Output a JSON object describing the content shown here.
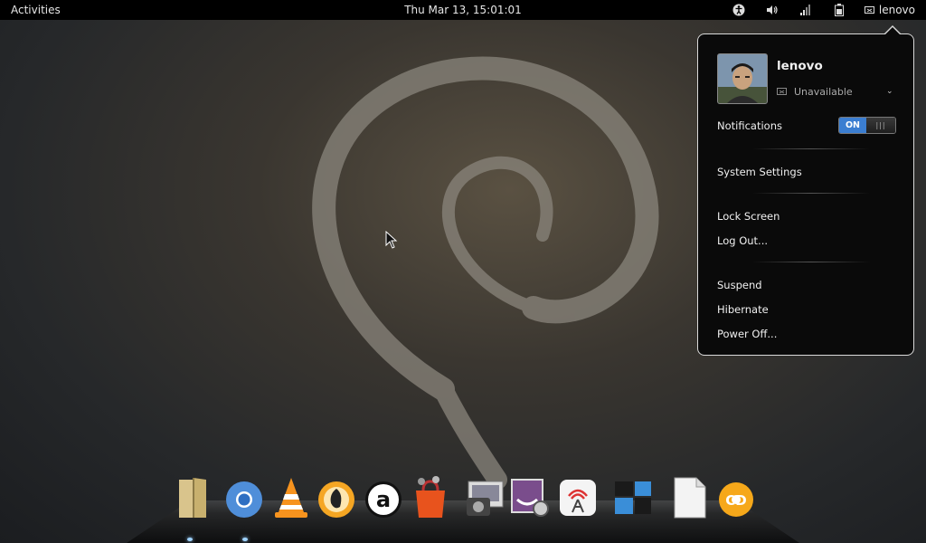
{
  "topbar": {
    "activities": "Activities",
    "clock": "Thu Mar 13, 15:01:01",
    "icons": [
      "accessibility-icon",
      "volume-icon",
      "network-signal-icon",
      "battery-icon"
    ],
    "user_label": "lenovo"
  },
  "user_menu": {
    "username": "lenovo",
    "status": "Unavailable",
    "notifications_label": "Notifications",
    "notifications_state": "ON",
    "items": {
      "system_settings": "System Settings",
      "lock_screen": "Lock Screen",
      "log_out": "Log Out...",
      "suspend": "Suspend",
      "hibernate": "Hibernate",
      "power_off": "Power Off..."
    },
    "toggle_color": "#3b7ed1"
  },
  "dock": {
    "apps": [
      "files-folder-icon",
      "chromium-icon",
      "vlc-icon",
      "audio-player-icon",
      "amazon-icon",
      "software-center-icon",
      "screenshot-icon",
      "image-viewer-icon",
      "network-broadcast-icon",
      "workspace-switcher-icon",
      "text-document-icon",
      "disc-burner-icon"
    ]
  }
}
